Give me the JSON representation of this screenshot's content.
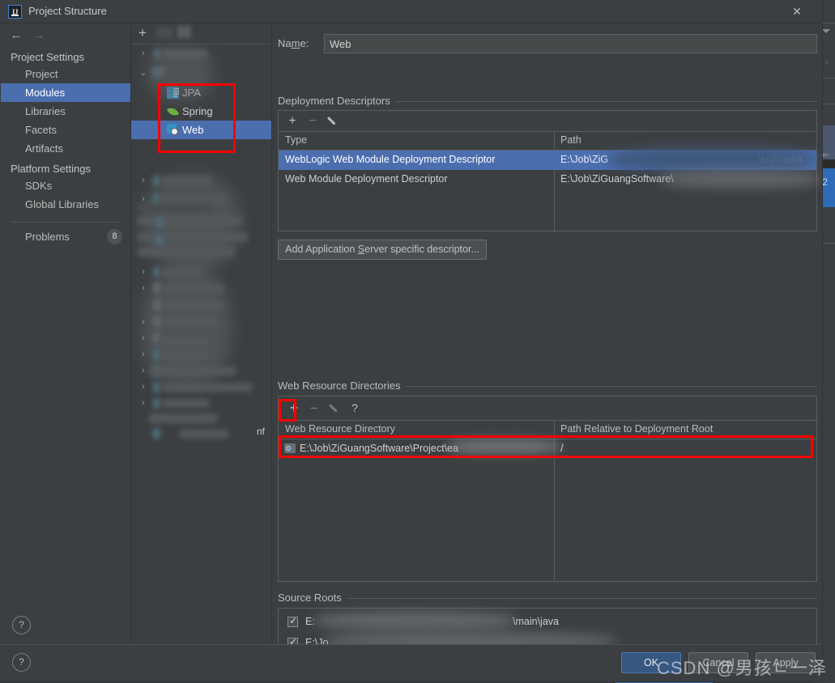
{
  "window": {
    "title": "Project Structure",
    "logo_text": "IJ",
    "close_icon": "✕"
  },
  "nav": {
    "back_icon": "←",
    "forward_icon": "→"
  },
  "sidebar": {
    "groups": [
      {
        "label": "Project Settings"
      },
      {
        "label": "Platform Settings"
      }
    ],
    "project_settings_items": [
      {
        "label": "Project",
        "selected": false
      },
      {
        "label": "Modules",
        "selected": true
      },
      {
        "label": "Libraries",
        "selected": false
      },
      {
        "label": "Facets",
        "selected": false
      },
      {
        "label": "Artifacts",
        "selected": false
      }
    ],
    "platform_settings_items": [
      {
        "label": "SDKs",
        "selected": false
      },
      {
        "label": "Global Libraries",
        "selected": false
      }
    ],
    "problems": {
      "label": "Problems",
      "count": "8"
    },
    "help_icon": "?"
  },
  "tree": {
    "toolbar": {
      "add_icon": "+"
    },
    "facets": [
      {
        "label": "JPA",
        "icon": "jpa-icon",
        "selected": false
      },
      {
        "label": "Spring",
        "icon": "spring-icon",
        "selected": false
      },
      {
        "label": "Web",
        "icon": "web-icon",
        "selected": true
      }
    ],
    "truncated_text": "nf",
    "chevron_collapsed": "›",
    "chevron_expanded": "⌄"
  },
  "module": {
    "name_label": "Name:",
    "name_value": "Web",
    "name_placeholder": ""
  },
  "deployment_descriptors": {
    "title": "Deployment Descriptors",
    "toolbar": {
      "add_icon": "+",
      "remove_icon": "−",
      "edit_icon": "pencil-icon"
    },
    "columns": [
      "Type",
      "Path"
    ],
    "rows": [
      {
        "type": "WebLogic Web Module Deployment Descriptor",
        "path_prefix": "E:\\Job\\ZiG",
        "path_suffix": "\\src\\main\\",
        "selected": true
      },
      {
        "type": "Web Module Deployment Descriptor",
        "path_prefix": "E:\\Job\\ZiGuangSoftware\\",
        "path_suffix": "",
        "selected": false
      }
    ],
    "add_descriptor_button": "Add Application Server specific descriptor..."
  },
  "web_resource_directories": {
    "title": "Web Resource Directories",
    "toolbar": {
      "add_icon": "+",
      "remove_icon": "−",
      "edit_icon": "pencil-icon",
      "help_icon": "?"
    },
    "columns": [
      "Web Resource Directory",
      "Path Relative to Deployment Root"
    ],
    "rows": [
      {
        "directory": "E:\\Job\\ZiGuangSoftware\\Project\\ea",
        "relative_path": "/"
      }
    ]
  },
  "source_roots": {
    "title": "Source Roots",
    "rows": [
      {
        "prefix": "E:",
        "suffix": "\\main\\java",
        "checked": true
      },
      {
        "prefix": "E:\\Jo",
        "suffix": "",
        "checked": true
      }
    ]
  },
  "footer": {
    "help_icon": "?",
    "ok_label": "OK",
    "cancel_label": "Cancel",
    "apply_label": "Apply"
  },
  "watermark": {
    "text": "CSDN @男孩ㄴ一泽"
  },
  "background_window": {
    "line_number": "2"
  },
  "colors": {
    "dialog_bg": "#3c3f41",
    "selection_blue": "#4b6eaf",
    "ok_button_blue": "#365880",
    "highlight_red": "#fb0000",
    "accent_cyan": "#3592c4",
    "spring_green": "#6db33f"
  }
}
